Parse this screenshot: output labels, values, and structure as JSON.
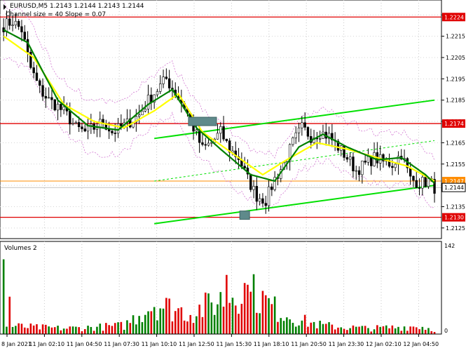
{
  "symbol_info": "EURUSD,M5  1.2143 1.2144 1.2143 1.2144",
  "indicator_info": "Channel size = 40 Slope = 0.07",
  "volume_label": "Volumes 2",
  "chart_data": {
    "type": "candlestick",
    "price_axis": {
      "ylim": [
        1.212,
        1.2232
      ],
      "ticks": [
        "1.2225",
        "1.2215",
        "1.2205",
        "1.2195",
        "1.2185",
        "1.2175",
        "1.2165",
        "1.2155",
        "1.2145",
        "1.2135",
        "1.2125"
      ]
    },
    "volume_axis": {
      "ylim": [
        0,
        142
      ],
      "ticks": [
        "142",
        "0"
      ]
    },
    "time_ticks": [
      "8 Jan 2021",
      "11 Jan 02:10",
      "11 Jan 04:50",
      "11 Jan 07:30",
      "11 Jan 10:10",
      "11 Jan 12:50",
      "11 Jan 15:30",
      "11 Jan 18:10",
      "11 Jan 20:50",
      "11 Jan 23:30",
      "12 Jan 02:10",
      "12 Jan 04:50"
    ],
    "levels": [
      {
        "price": 1.2224,
        "label": "1.2224",
        "color": "#e00000"
      },
      {
        "price": 1.2174,
        "label": "1.2174",
        "color": "#e00000"
      },
      {
        "price": 1.213,
        "label": "1.2130",
        "color": "#e00000"
      }
    ],
    "current_price": {
      "price": 1.2144,
      "label": "1.2144"
    },
    "orange_level": {
      "price": 1.2147,
      "label": "1.2147",
      "color": "#ff8c00"
    },
    "close_path": [
      [
        0,
        1.222
      ],
      [
        3,
        1.2222
      ],
      [
        6,
        1.2218
      ],
      [
        9,
        1.22
      ],
      [
        12,
        1.219
      ],
      [
        15,
        1.2185
      ],
      [
        18,
        1.2182
      ],
      [
        21,
        1.2178
      ],
      [
        24,
        1.2172
      ],
      [
        27,
        1.217
      ],
      [
        30,
        1.2172
      ],
      [
        33,
        1.2175
      ],
      [
        36,
        1.217
      ],
      [
        39,
        1.2172
      ],
      [
        42,
        1.2175
      ],
      [
        45,
        1.2178
      ],
      [
        48,
        1.2185
      ],
      [
        51,
        1.219
      ],
      [
        54,
        1.2195
      ],
      [
        57,
        1.2188
      ],
      [
        60,
        1.2182
      ],
      [
        63,
        1.2172
      ],
      [
        66,
        1.2162
      ],
      [
        69,
        1.2165
      ],
      [
        72,
        1.217
      ],
      [
        75,
        1.2162
      ],
      [
        78,
        1.2158
      ],
      [
        81,
        1.2148
      ],
      [
        84,
        1.214
      ],
      [
        87,
        1.2138
      ],
      [
        90,
        1.2148
      ],
      [
        93,
        1.2155
      ],
      [
        96,
        1.2165
      ],
      [
        99,
        1.2172
      ],
      [
        102,
        1.2168
      ],
      [
        105,
        1.217
      ],
      [
        108,
        1.2168
      ],
      [
        111,
        1.2163
      ],
      [
        114,
        1.2158
      ],
      [
        117,
        1.2152
      ],
      [
        120,
        1.2155
      ],
      [
        123,
        1.2158
      ],
      [
        126,
        1.2156
      ],
      [
        129,
        1.2155
      ],
      [
        132,
        1.216
      ],
      [
        135,
        1.2148
      ],
      [
        138,
        1.2146
      ],
      [
        141,
        1.2147
      ],
      [
        143,
        1.2144
      ]
    ],
    "series": [
      {
        "color": "#ffff00",
        "values": [
          [
            0,
            1.2215
          ],
          [
            10,
            1.2205
          ],
          [
            20,
            1.2183
          ],
          [
            30,
            1.2175
          ],
          [
            40,
            1.2172
          ],
          [
            50,
            1.218
          ],
          [
            58,
            1.2188
          ],
          [
            66,
            1.217
          ],
          [
            76,
            1.216
          ],
          [
            86,
            1.215
          ],
          [
            94,
            1.2157
          ],
          [
            104,
            1.2165
          ],
          [
            114,
            1.2162
          ],
          [
            124,
            1.2158
          ],
          [
            134,
            1.2154
          ],
          [
            143,
            1.2147
          ]
        ]
      },
      {
        "color": "#008000",
        "values": [
          [
            0,
            1.2218
          ],
          [
            8,
            1.2212
          ],
          [
            18,
            1.2185
          ],
          [
            28,
            1.2173
          ],
          [
            38,
            1.2171
          ],
          [
            48,
            1.2183
          ],
          [
            56,
            1.219
          ],
          [
            64,
            1.2172
          ],
          [
            72,
            1.2162
          ],
          [
            82,
            1.215
          ],
          [
            90,
            1.2147
          ],
          [
            98,
            1.2163
          ],
          [
            106,
            1.2169
          ],
          [
            114,
            1.2163
          ],
          [
            124,
            1.2157
          ],
          [
            132,
            1.2158
          ],
          [
            140,
            1.215
          ],
          [
            143,
            1.2146
          ]
        ]
      }
    ],
    "channel_lines": [
      {
        "color": "#00e000",
        "from": [
          50,
          1.2167
        ],
        "to": [
          143,
          1.2185
        ]
      },
      {
        "color": "#00e000",
        "from": [
          50,
          1.2127
        ],
        "to": [
          143,
          1.2145
        ]
      },
      {
        "color": "#00e000",
        "dashed": true,
        "from": [
          50,
          1.2147
        ],
        "to": [
          143,
          1.2166
        ]
      }
    ],
    "markers": [
      {
        "x": 66,
        "price": 1.2175
      },
      {
        "x": 80,
        "price": 1.2131
      }
    ],
    "volume_base": [
      [
        0,
        15
      ],
      [
        10,
        12
      ],
      [
        20,
        10
      ],
      [
        30,
        12
      ],
      [
        40,
        15
      ],
      [
        46,
        40
      ],
      [
        50,
        55
      ],
      [
        56,
        45
      ],
      [
        62,
        38
      ],
      [
        70,
        55
      ],
      [
        78,
        80
      ],
      [
        84,
        70
      ],
      [
        90,
        45
      ],
      [
        98,
        25
      ],
      [
        106,
        15
      ],
      [
        114,
        12
      ],
      [
        122,
        10
      ],
      [
        130,
        12
      ],
      [
        138,
        14
      ],
      [
        143,
        8
      ]
    ],
    "volume_spikes": [
      [
        0,
        120
      ],
      [
        2,
        60
      ],
      [
        74,
        95
      ],
      [
        80,
        82
      ],
      [
        82,
        68
      ]
    ]
  }
}
